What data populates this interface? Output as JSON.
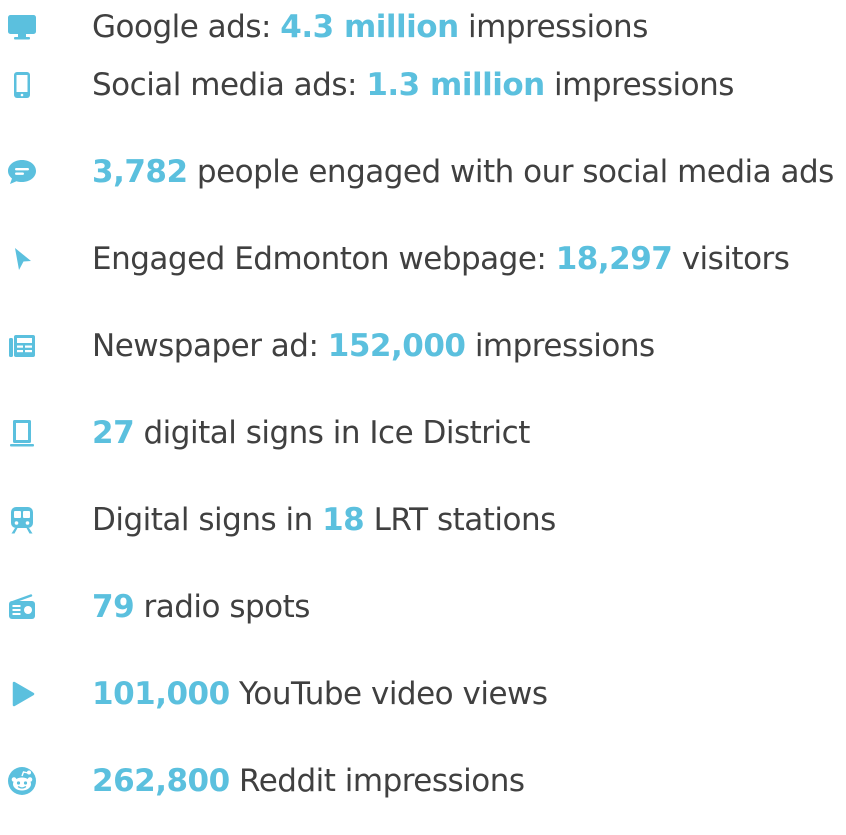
{
  "accent_color": "#5bc0de",
  "text_color": "#404040",
  "stats": [
    {
      "icon": "desktop-icon",
      "pre": "Google ads: ",
      "value": "4.3 million",
      "post": " impressions"
    },
    {
      "icon": "mobile-icon",
      "pre": "Social media ads: ",
      "value": "1.3 million",
      "post": " impressions"
    },
    {
      "icon": "chat-icon",
      "pre": "",
      "value": "3,782",
      "post": " people engaged with our social media ads"
    },
    {
      "icon": "cursor-icon",
      "pre": "Engaged Edmonton webpage: ",
      "value": "18,297",
      "post": " visitors"
    },
    {
      "icon": "newspaper-icon",
      "pre": "Newspaper ad: ",
      "value": "152,000",
      "post": " impressions"
    },
    {
      "icon": "tablet-icon",
      "pre": "",
      "value": "27",
      "post": " digital signs in Ice District"
    },
    {
      "icon": "train-icon",
      "pre": "Digital signs in ",
      "value": "18",
      "post": " LRT stations"
    },
    {
      "icon": "radio-icon",
      "pre": "",
      "value": "79",
      "post": " radio spots"
    },
    {
      "icon": "play-icon",
      "pre": "",
      "value": "101,000",
      "post": " YouTube video views"
    },
    {
      "icon": "reddit-icon",
      "pre": "",
      "value": "262,800",
      "post": " Reddit impressions"
    }
  ]
}
